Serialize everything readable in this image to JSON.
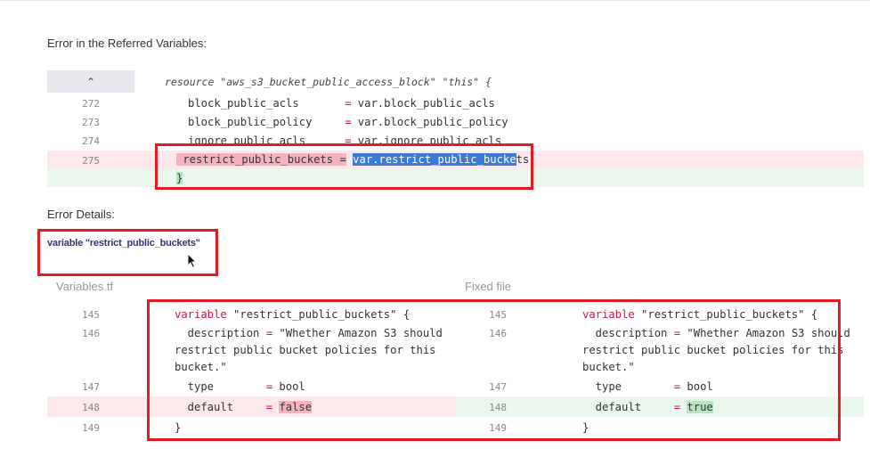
{
  "headings": {
    "referred": "Error in the Referred Variables:",
    "details": "Error Details:"
  },
  "top_snippet": {
    "expand_icon": "chevron-up-icon",
    "expand_glyph": "⌃",
    "resource_line": "resource \"aws_s3_bucket_public_access_block\" \"this\" {",
    "lines": [
      {
        "num": "272",
        "key": "block_public_acls      ",
        "eq": "=",
        "val": "var.block_public_acls"
      },
      {
        "num": "273",
        "key": "block_public_policy    ",
        "eq": "=",
        "val": "var.block_public_policy"
      },
      {
        "num": "274",
        "key": "ignore_public_acls     ",
        "eq": "=",
        "val": "var.ignore_public_acls"
      },
      {
        "num": "275",
        "key": "restrict_public_buckets",
        "eq": "=",
        "val_selected": "var.restrict_public_bucke",
        "val_tail": "ts"
      }
    ],
    "closing_brace": "}"
  },
  "variable_link": "variable \"restrict_public_buckets\"",
  "columns": {
    "left_label": "Variables.tf",
    "right_label": "Fixed file"
  },
  "left_code": {
    "nums": [
      "145",
      "146",
      "147",
      "148",
      "149"
    ],
    "var_kw": "variable",
    "var_name": " \"restrict_public_buckets\" {",
    "desc_key": "  description ",
    "desc_eq": "=",
    "desc_val1": " \"Whether Amazon S3 should",
    "desc_val2": "restrict public bucket policies for this",
    "desc_val3": "bucket.\"",
    "type_key": "  type        ",
    "type_eq": "=",
    "type_val": " bool",
    "default_key": "  default     ",
    "default_eq": "=",
    "default_val": "false",
    "close": "}"
  },
  "right_code": {
    "nums": [
      "145",
      "146",
      "147",
      "148",
      "149"
    ],
    "var_kw": "variable",
    "var_name": " \"restrict_public_buckets\" {",
    "desc_key": "  description ",
    "desc_eq": "=",
    "desc_val1": " \"Whether Amazon S3 should",
    "desc_val2": "restrict public bucket policies for this",
    "desc_val3": "bucket.\"",
    "type_key": "  type        ",
    "type_eq": "=",
    "type_val": " bool",
    "default_key": "  default     ",
    "default_eq": "=",
    "default_val": "true",
    "close": "}"
  },
  "colors": {
    "removed_row": "#fde8ec",
    "added_row": "#e9f7ec",
    "highlight_box": "#e21b25",
    "keyword": "#c8174c",
    "link": "#3b2f7a"
  }
}
